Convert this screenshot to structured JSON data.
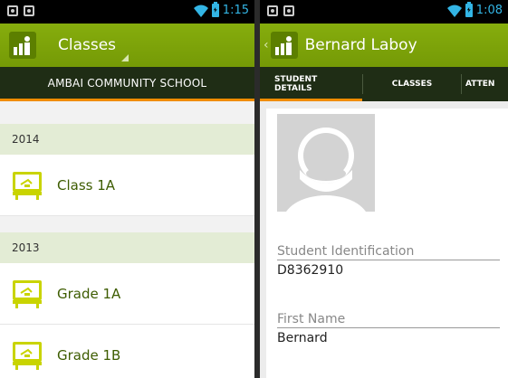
{
  "left": {
    "status": {
      "time": "1:15"
    },
    "actionbar": {
      "title": "Classes"
    },
    "school": "AMBAI COMMUNITY SCHOOL",
    "sections": [
      {
        "year": "2014",
        "items": [
          "Class 1A"
        ]
      },
      {
        "year": "2013",
        "items": [
          "Grade 1A",
          "Grade 1B"
        ]
      }
    ]
  },
  "right": {
    "status": {
      "time": "1:08"
    },
    "actionbar": {
      "title": "Bernard Laboy"
    },
    "tabs": {
      "details_line1": "STUDENT",
      "details_line2": "DETAILS",
      "classes": "CLASSES",
      "attendance": "ATTEN"
    },
    "fields": [
      {
        "label": "Student Identification",
        "value": "D8362910"
      },
      {
        "label": "First Name",
        "value": "Bernard"
      }
    ]
  },
  "colors": {
    "accent": "#7ea309",
    "tab_indicator": "#f08c00",
    "status_blue": "#33b5e5"
  },
  "icons": [
    "app-logo-icon",
    "classroom-board-icon",
    "wifi-icon",
    "battery-icon",
    "avatar-placeholder-icon",
    "back-chevron-icon"
  ]
}
